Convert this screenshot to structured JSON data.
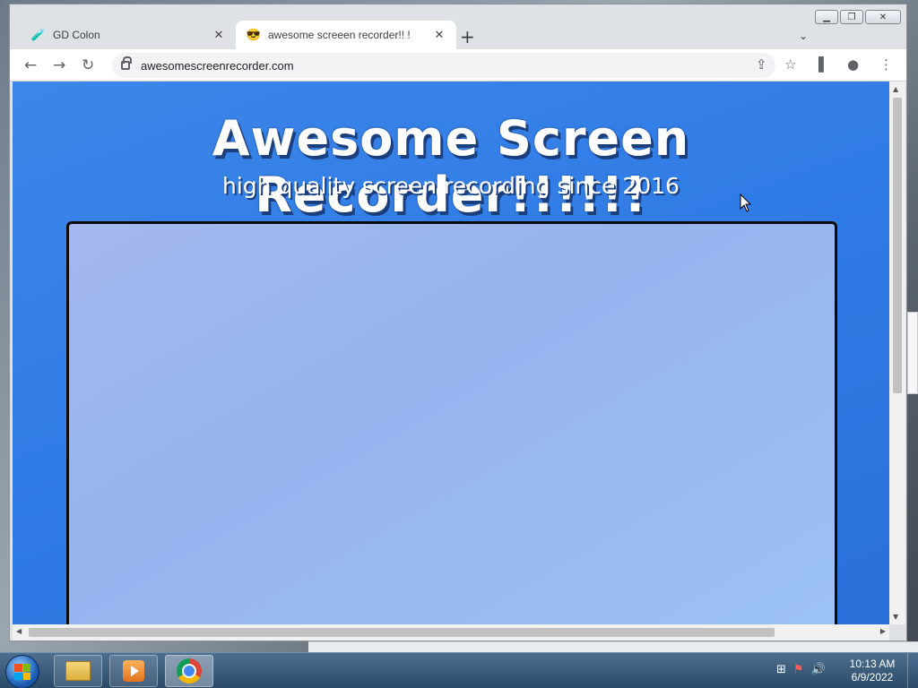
{
  "browser": {
    "tabs": [
      {
        "title": "GD Colon",
        "favicon": "gd-colon-favicon",
        "active": false
      },
      {
        "title": "awesome screeen recorder!! !",
        "favicon": "screen-recorder-favicon",
        "active": true
      }
    ],
    "url": "awesomescreenrecorder.com",
    "window_controls": [
      "minimize",
      "restore",
      "close"
    ]
  },
  "page": {
    "title": "Awesome Screen Recorder!!!!!!",
    "subtitle": "high quality screen recording since 2016"
  },
  "taskbar": {
    "apps": [
      "start-button",
      "file-explorer",
      "media-player",
      "chrome"
    ],
    "clock": {
      "time": "10:13 AM",
      "date": "6/9/2022"
    }
  },
  "colors": {
    "page_bg": "#2f7be6",
    "record_area": "#9ab8ef",
    "tab_bar": "#dee1e6"
  }
}
